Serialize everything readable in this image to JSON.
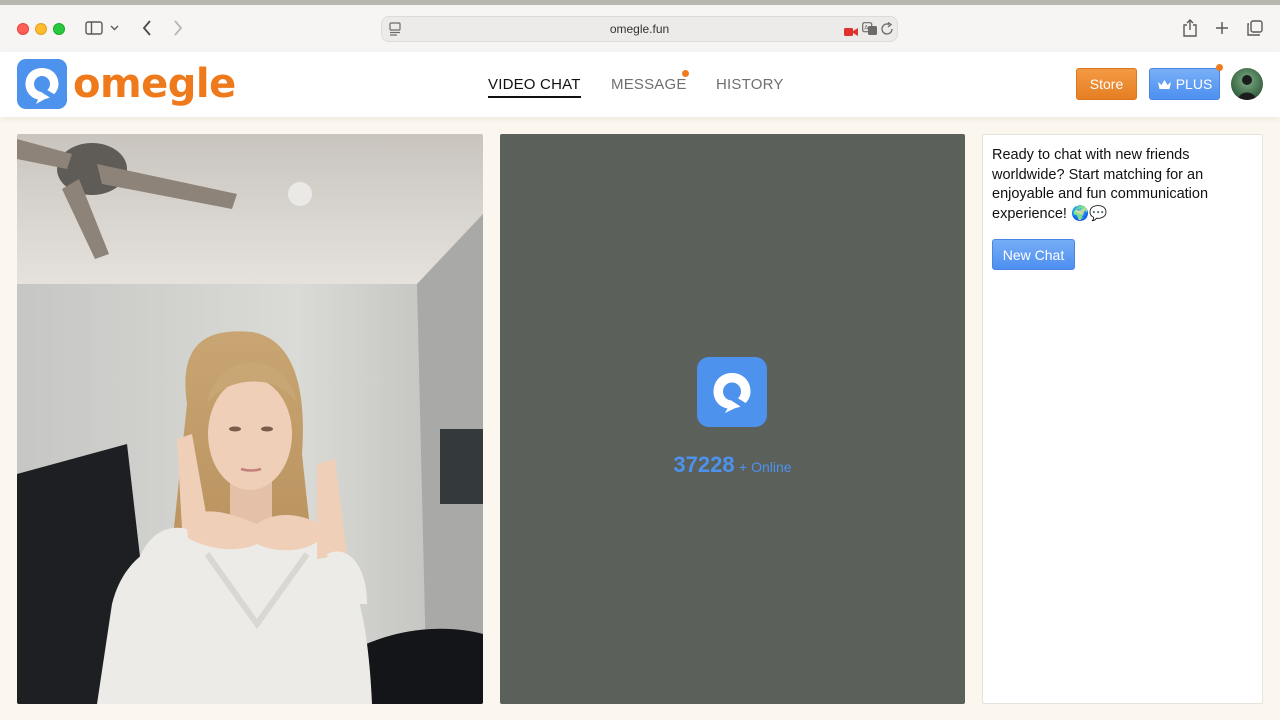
{
  "browser": {
    "address": "omegle.fun"
  },
  "site": {
    "logo_text": "omegle",
    "nav": {
      "video_chat": "VIDEO CHAT",
      "message": "MESSAGE",
      "history": "HISTORY"
    },
    "store_label": "Store",
    "plus_label": "PLUS"
  },
  "main": {
    "online_count": "37228",
    "online_label": "+ Online",
    "welcome_text": "Ready to chat with new friends worldwide? Start matching for an enjoyable and fun communication experience! 🌍💬",
    "new_chat_label": "New Chat"
  },
  "colors": {
    "brand_orange": "#ef7a1c",
    "brand_blue": "#4d93ee",
    "remote_panel_bg": "#5b605b"
  }
}
